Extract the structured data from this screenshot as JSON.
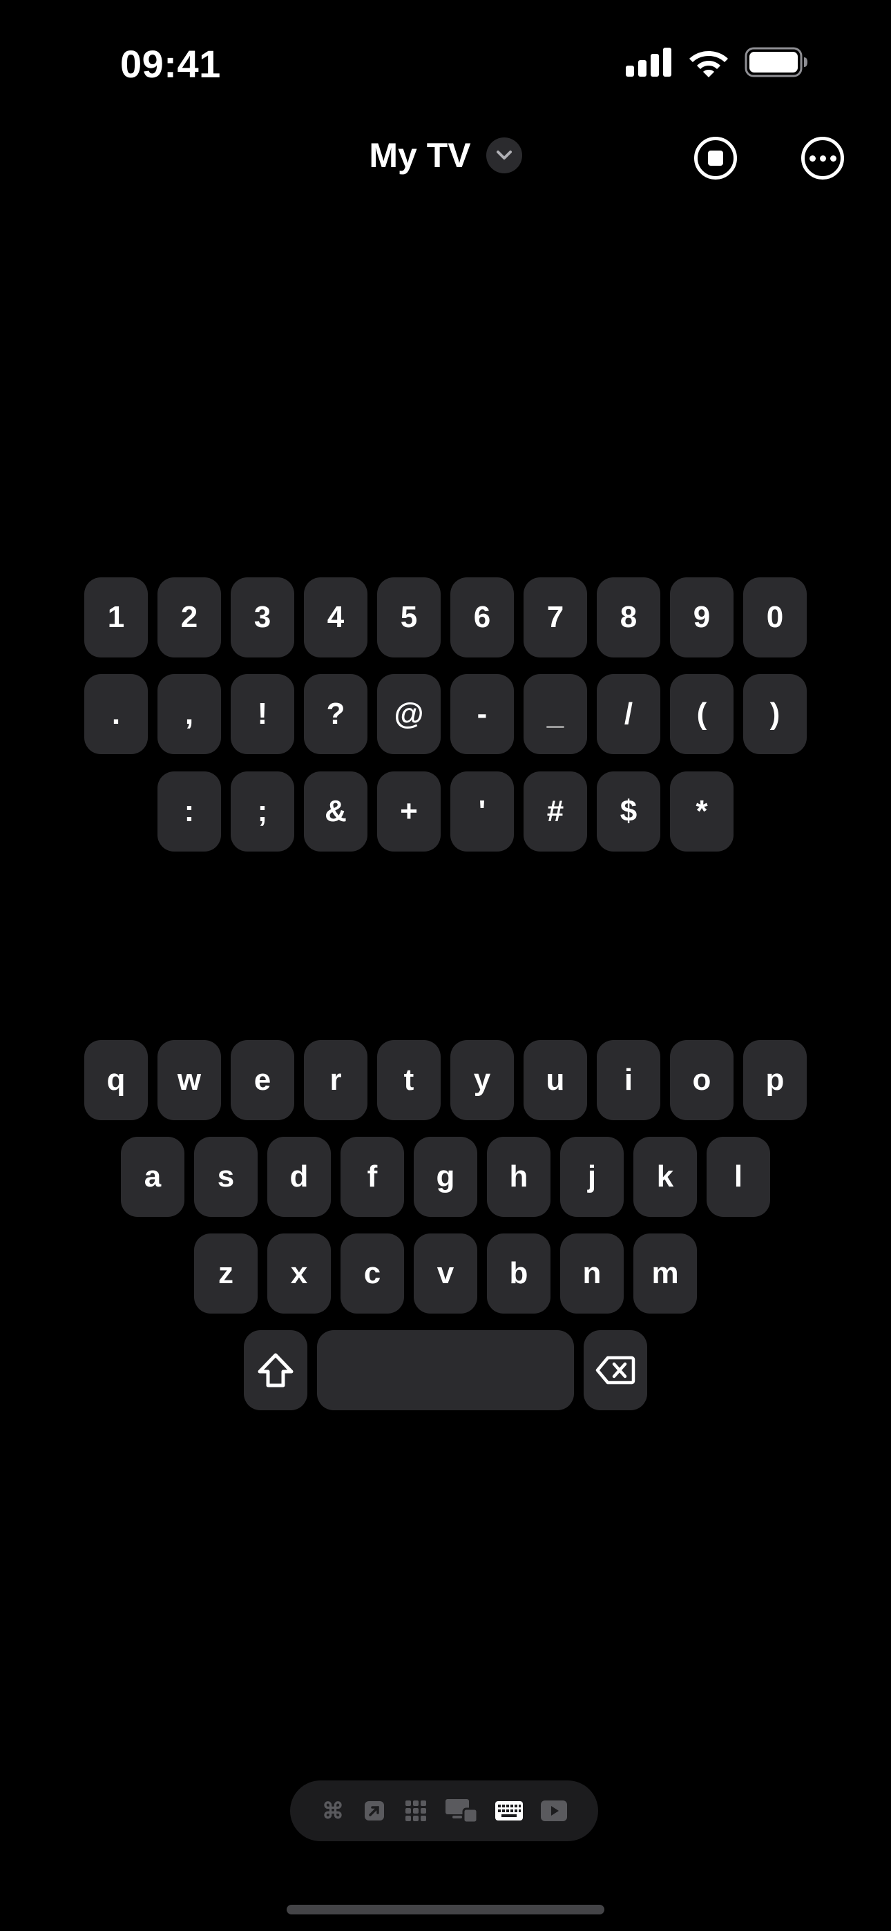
{
  "status_bar": {
    "time": "09:41",
    "icons": [
      "signal-icon",
      "wifi-icon",
      "battery-icon"
    ]
  },
  "header": {
    "title": "My TV",
    "icons": [
      "chevron-down-icon",
      "stop-icon",
      "more-icon"
    ]
  },
  "keyboard": {
    "numbers": [
      "1",
      "2",
      "3",
      "4",
      "5",
      "6",
      "7",
      "8",
      "9",
      "0"
    ],
    "symbols_row1": [
      ".",
      ",",
      "!",
      "?",
      "@",
      "-",
      "_",
      "/",
      "(",
      ")"
    ],
    "symbols_row2": [
      ":",
      ";",
      "&",
      "+",
      "'",
      "#",
      "$",
      "*"
    ],
    "letters_row1": [
      "q",
      "w",
      "e",
      "r",
      "t",
      "y",
      "u",
      "i",
      "o",
      "p"
    ],
    "letters_row2": [
      "a",
      "s",
      "d",
      "f",
      "g",
      "h",
      "j",
      "k",
      "l"
    ],
    "letters_row3": [
      "z",
      "x",
      "c",
      "v",
      "b",
      "n",
      "m"
    ],
    "special_keys": [
      "shift-icon",
      "space",
      "backspace-icon"
    ]
  },
  "dock": {
    "items": [
      "command-icon",
      "arrow-box-icon",
      "grid-icon",
      "devices-icon",
      "keyboard-icon",
      "play-icon"
    ],
    "active": "keyboard-icon"
  },
  "colors": {
    "background": "#000000",
    "key": "#2b2b2e",
    "dock": "#1c1c1e",
    "inactive_icon": "#5a5a5e"
  }
}
